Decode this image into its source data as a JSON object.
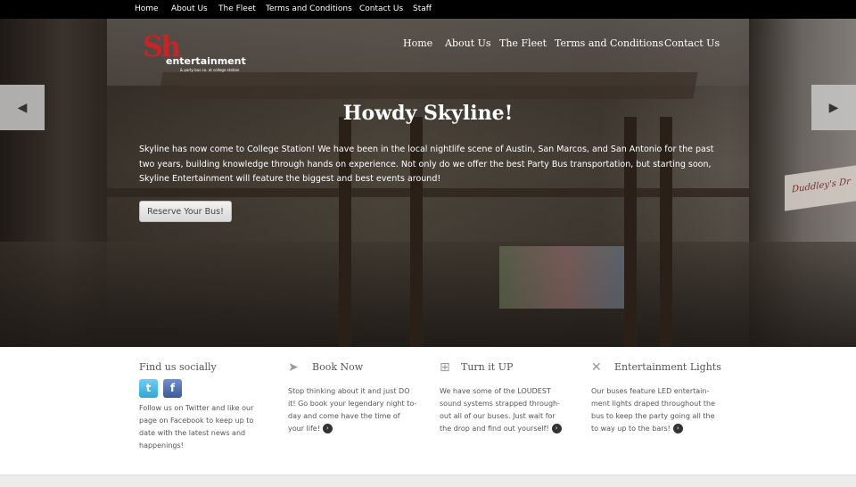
{
  "topnav": [
    "Home",
    "About Us",
    "The Fleet",
    "Terms and Conditions",
    "Contact Us",
    "Staff"
  ],
  "logo": {
    "mark": "Sh",
    "word": "entertainment",
    "tagline": "& party bus co. at college station"
  },
  "mainnav": [
    "Home",
    "About Us",
    "The Fleet",
    "Terms and Conditions",
    "Contact Us"
  ],
  "slider": {
    "prev_icon": "chevron-left-icon",
    "next_icon": "chevron-right-icon",
    "prev_glyph": "◀",
    "next_glyph": "▶"
  },
  "hero": {
    "title": "Howdy Skyline!",
    "text": "Skyline has now come to College Station! We have been in the local nightlife scene of Austin, San Marcos, and San Antonio for the past two years, building knowledge through hands on experience. Not only do we offer the best Party Bus transportation, but starting soon, Skyline Entertainment will feature the biggest and best events around!",
    "button": "Reserve Your Bus!",
    "sign_text": "Duddley's Dr"
  },
  "features": {
    "social": {
      "title": "Find us socially",
      "twitter_glyph": "t",
      "facebook_glyph": "f",
      "text": "Follow us on Twitter and like our page on Facebook to keep up to date with the latest news and happenings!"
    },
    "book": {
      "title": "Book Now",
      "icon": "paper-plane-icon",
      "glyph": "➤",
      "text": "Stop thinking about it and just DO it! Go book your legendary night to-day and come have the time of your life!"
    },
    "turn": {
      "title": "Turn it UP",
      "icon": "basket-icon",
      "glyph": "⊞",
      "text": "We have some of the LOUDEST sound systems strapped through-out all of our buses. Just wait for the drop and find out yourself!"
    },
    "lights": {
      "title": "Entertainment Lights",
      "icon": "crossed-tools-icon",
      "glyph": "✕",
      "text": "Our buses feature LED entertain-ment lights draped throughout the bus to keep the party going all the to way up to the bars!"
    },
    "more_glyph": "›"
  },
  "colors": {
    "brand_red": "#c0262a",
    "topbar": "#000000",
    "text_gray": "#555555"
  }
}
